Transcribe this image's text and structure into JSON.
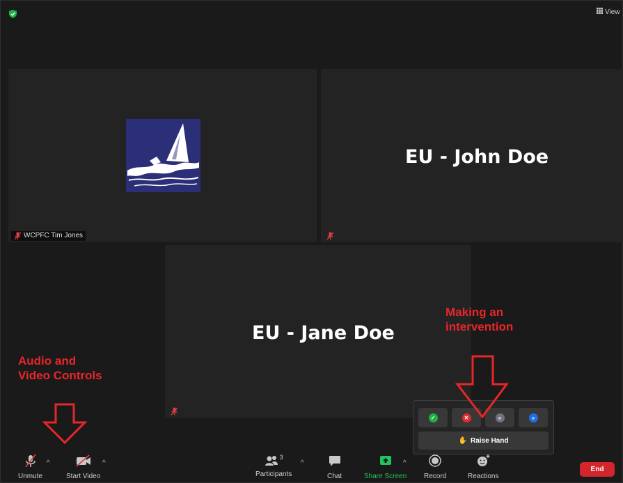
{
  "top": {
    "view_label": "View"
  },
  "tiles": {
    "tim": {
      "name_tag": "WCPFC Tim Jones"
    },
    "john": {
      "display_name": "EU - John Doe"
    },
    "jane": {
      "display_name": "EU - Jane Doe"
    }
  },
  "annotations": {
    "audio_video": [
      "Audio and",
      "Video Controls"
    ],
    "intervention": [
      "Making an",
      "intervention"
    ]
  },
  "reactions_popup": {
    "raise_hand_label": "Raise Hand",
    "colors": {
      "yes": "#1fb143",
      "no": "#e02a2a",
      "slower": "#6f7280",
      "faster": "#1e6fe6"
    }
  },
  "toolbar": {
    "unmute_label": "Unmute",
    "start_video_label": "Start Video",
    "participants_label": "Participants",
    "participants_count": "3",
    "chat_label": "Chat",
    "share_screen_label": "Share Screen",
    "record_label": "Record",
    "reactions_label": "Reactions",
    "end_label": "End"
  },
  "colors": {
    "accent_red": "#e8262a",
    "share_green": "#22c35e",
    "end_red": "#d3252b"
  }
}
